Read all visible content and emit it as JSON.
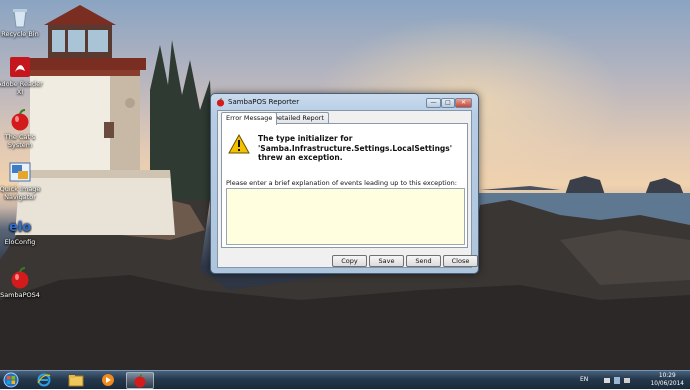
{
  "desktop": {
    "icons": [
      {
        "label": "Recycle Bin",
        "icon": "recycle-bin-icon"
      },
      {
        "label": "Adobe Reader XI",
        "icon": "adobe-reader-icon"
      },
      {
        "label": "The Cat's System",
        "icon": "apple-icon"
      },
      {
        "label": "Quick Image Navigator",
        "icon": "image-navigator-icon"
      },
      {
        "label": "EloConfig",
        "icon": "elo-icon"
      },
      {
        "label": "SambaPOS4",
        "icon": "apple-icon"
      }
    ]
  },
  "dialog": {
    "title": "SambaPOS Reporter",
    "tabs": [
      {
        "label": "Error Message",
        "active": true
      },
      {
        "label": "Detailed Report",
        "active": false
      }
    ],
    "error_message": "The type initializer for 'Samba.Infrastructure.Settings.LocalSettings' threw an exception.",
    "prompt": "Please enter a brief explanation of events leading up to this exception:",
    "explanation_value": "",
    "buttons": {
      "copy": "Copy",
      "save": "Save",
      "send": "Send",
      "close": "Close"
    },
    "caption_buttons": {
      "minimize": "—",
      "maximize": "□",
      "close": "✕"
    }
  },
  "taskbar": {
    "language": "EN",
    "time": "10:29",
    "date": "10/06/2014",
    "pinned": [
      "start-orb-icon",
      "internet-explorer-icon",
      "file-explorer-icon",
      "media-player-icon",
      "sambapos-icon"
    ]
  },
  "colors": {
    "dialog_frame": "#b5cce4",
    "input_background": "#ffffe0",
    "taskbar": "#25384c",
    "warning": "#f2c200"
  }
}
